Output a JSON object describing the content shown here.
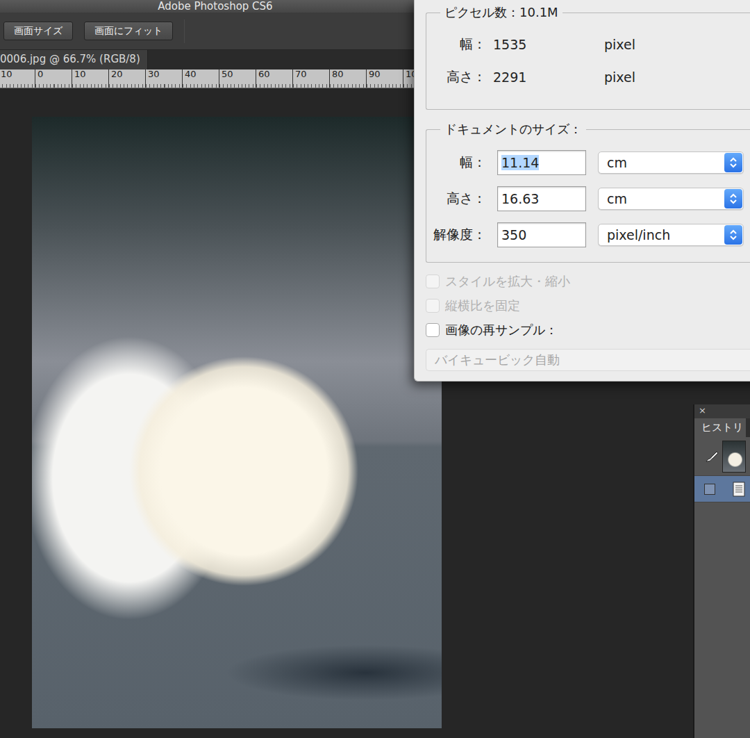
{
  "app": {
    "title": "Adobe Photoshop CS6"
  },
  "toolbar": {
    "buttons": [
      "画面サイズ",
      "画面にフィット"
    ]
  },
  "document_tab": {
    "label": "0006.jpg @ 66.7% (RGB/8)"
  },
  "ruler": {
    "labels": [
      "10",
      "0",
      "10",
      "20",
      "30",
      "40",
      "50",
      "60",
      "70",
      "80",
      "90",
      "10"
    ]
  },
  "dialog": {
    "pixel_dimensions": {
      "label": "ピクセル数：10.1M",
      "rows": [
        {
          "label": "幅：",
          "value": "1535",
          "unit": "pixel"
        },
        {
          "label": "高さ：",
          "value": "2291",
          "unit": "pixel"
        }
      ]
    },
    "document_size": {
      "label": "ドキュメントのサイズ：",
      "fields": [
        {
          "label": "幅：",
          "value": "11.14",
          "unit": "cm",
          "selected": true
        },
        {
          "label": "高さ：",
          "value": "16.63",
          "unit": "cm",
          "selected": false
        },
        {
          "label": "解像度：",
          "value": "350",
          "unit": "pixel/inch",
          "selected": false
        }
      ]
    },
    "options": [
      {
        "label": "スタイルを拡大・縮小",
        "checked": false,
        "disabled": true
      },
      {
        "label": "縦横比を固定",
        "checked": false,
        "disabled": true
      },
      {
        "label": "画像の再サンプル：",
        "checked": false,
        "disabled": false
      }
    ],
    "method": {
      "value": "バイキュービック自動",
      "disabled": true
    }
  },
  "history": {
    "close": "×",
    "tab": "ヒストリ",
    "items": [
      {
        "kind": "snapshot",
        "selected": false
      },
      {
        "kind": "state",
        "selected": true
      }
    ]
  }
}
